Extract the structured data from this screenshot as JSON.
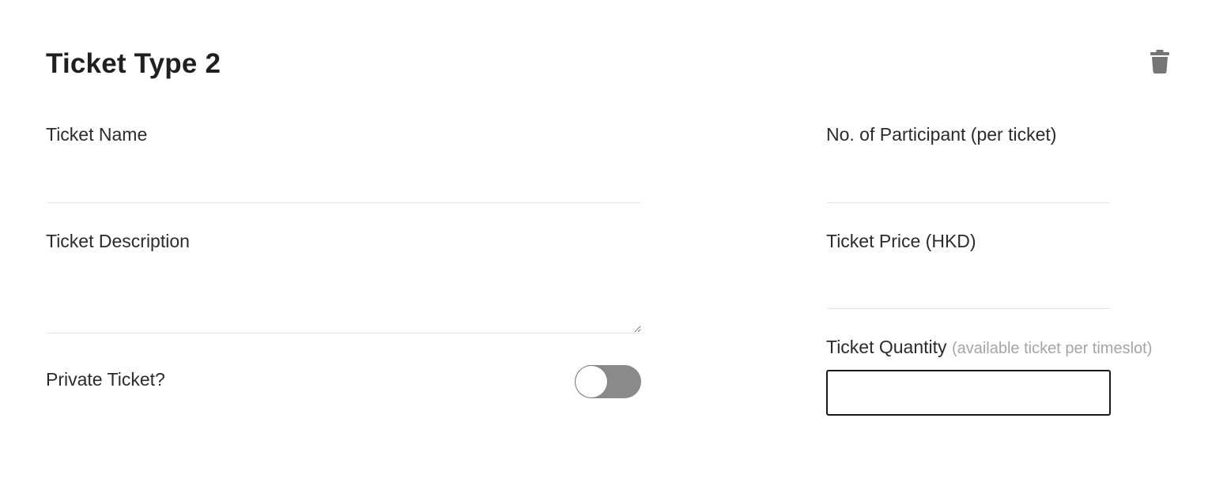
{
  "header": {
    "title": "Ticket Type 2",
    "delete_icon": "trash-icon"
  },
  "form": {
    "ticket_name": {
      "label": "Ticket Name",
      "value": ""
    },
    "ticket_description": {
      "label": "Ticket Description",
      "value": ""
    },
    "private_ticket": {
      "label": "Private Ticket?",
      "checked": false
    },
    "participants": {
      "label": "No. of Participant (per ticket)",
      "value": ""
    },
    "ticket_price": {
      "label": "Ticket Price (HKD)",
      "value": ""
    },
    "ticket_quantity": {
      "label": "Ticket Quantity",
      "hint": "(available ticket per timeslot)",
      "value": ""
    }
  },
  "colors": {
    "toggle_track": "#8a8a8a",
    "hint_text": "#a5a5a5",
    "field_border": "#1a1a1a",
    "icon": "#757575"
  }
}
